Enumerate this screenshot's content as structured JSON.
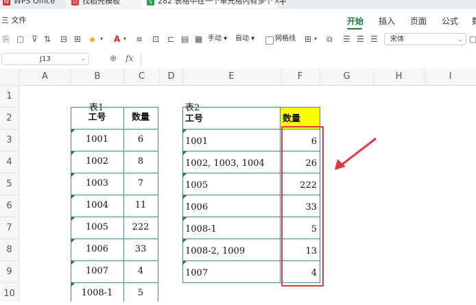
{
  "tabs": {
    "wps": "WPS Office",
    "doc": "找稻壳模板",
    "active": "282 表格中在一个单元格内有多个",
    "close": "×",
    "add": "+"
  },
  "menu": {
    "file": "三 文件",
    "home": "开始",
    "insert": "插入",
    "page": "页面",
    "formula": "公式",
    "more": "数"
  },
  "toolbar": {
    "manual": "手动",
    "auto": "自动",
    "gridlines": "网格线",
    "font": "宋体"
  },
  "formula_bar": {
    "cell_ref": "J13",
    "fx": "fx",
    "zoom": "⊕"
  },
  "columns": [
    "A",
    "B",
    "C",
    "D",
    "E",
    "F",
    "G",
    "H",
    "I"
  ],
  "rows": [
    "1",
    "2",
    "3",
    "4",
    "5",
    "6",
    "7",
    "8",
    "9",
    "10"
  ],
  "table1": {
    "caption": "表1",
    "headers": [
      "工号",
      "数量"
    ],
    "rows": [
      [
        "1001",
        "6"
      ],
      [
        "1002",
        "8"
      ],
      [
        "1003",
        "7"
      ],
      [
        "1004",
        "11"
      ],
      [
        "1005",
        "222"
      ],
      [
        "1006",
        "33"
      ],
      [
        "1007",
        "4"
      ],
      [
        "1008-1",
        "5"
      ]
    ]
  },
  "table2": {
    "caption": "表2",
    "headers": [
      "工号",
      "数量"
    ],
    "rows": [
      [
        "1001",
        "6"
      ],
      [
        "1002, 1003, 1004",
        "26"
      ],
      [
        "1005",
        "222"
      ],
      [
        "1006",
        "33"
      ],
      [
        "1008-1",
        "5"
      ],
      [
        "1008-2, 1009",
        "13"
      ],
      [
        "1007",
        "4"
      ]
    ]
  },
  "colors": {
    "accent_green": "#1d7a3c",
    "highlight_yellow": "#ffff00",
    "annotation_red": "#e8333c",
    "table_border": "#3a86b9"
  }
}
